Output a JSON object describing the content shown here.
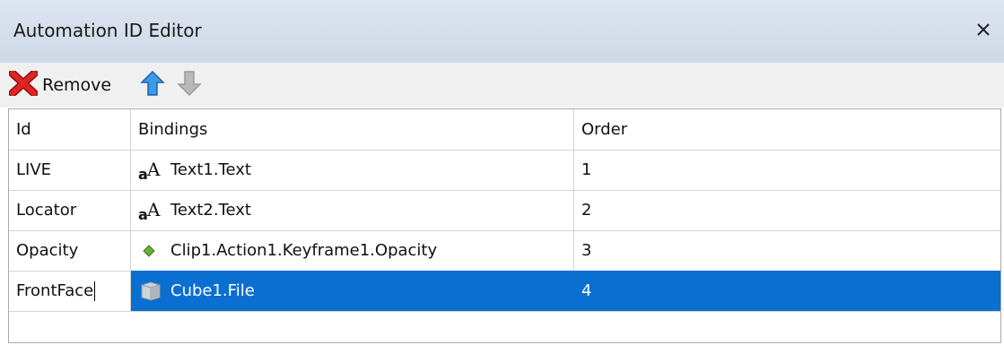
{
  "window": {
    "title": "Automation ID Editor",
    "close_glyph": "✕"
  },
  "toolbar": {
    "remove_label": "Remove",
    "remove_icon": "red-x-icon",
    "move_up_icon": "blue-up-arrow-icon",
    "move_down_icon": "gray-down-arrow-icon"
  },
  "grid": {
    "columns": [
      "Id",
      "Bindings",
      "Order"
    ],
    "rows": [
      {
        "id": "LIVE",
        "binding_icon": "text-font-icon",
        "binding": "Text1.Text",
        "order": "1"
      },
      {
        "id": "Locator",
        "binding_icon": "text-font-icon",
        "binding": "Text2.Text",
        "order": "2"
      },
      {
        "id": "Opacity",
        "binding_icon": "green-diamond-keyframe-icon",
        "binding": "Clip1.Action1.Keyframe1.Opacity",
        "order": "3"
      },
      {
        "id": "FrontFace",
        "binding_icon": "cube-icon",
        "binding": "Cube1.File",
        "order": "4"
      }
    ],
    "selected_row": 3,
    "selection_color": "#0a6fd1"
  }
}
